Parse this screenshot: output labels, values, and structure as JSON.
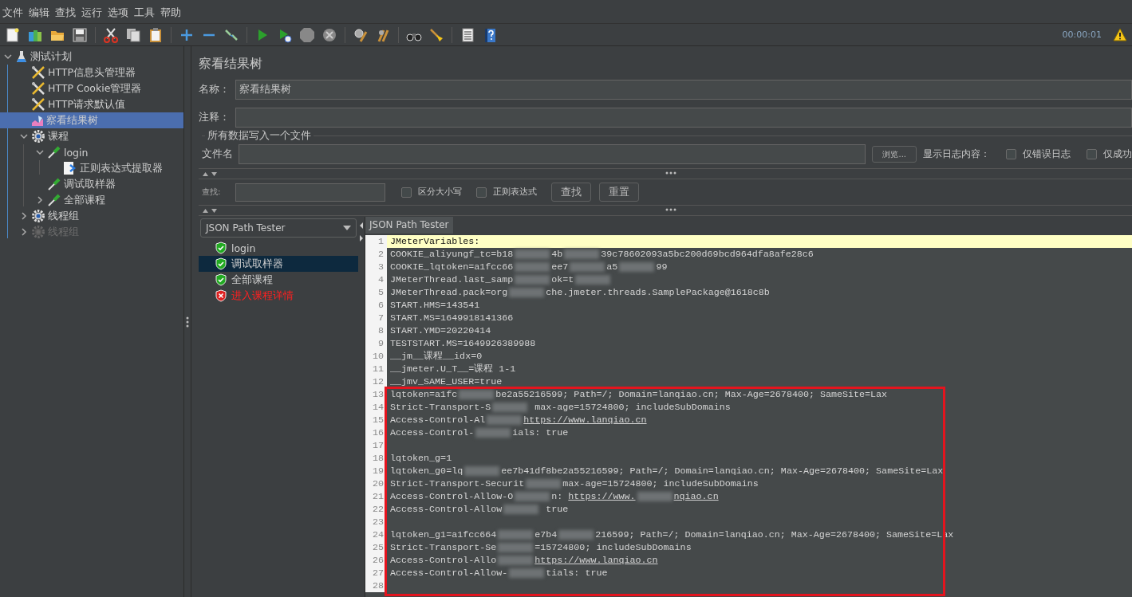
{
  "menu": [
    "文件",
    "编辑",
    "查找",
    "运行",
    "选项",
    "工具",
    "帮助"
  ],
  "toolbar": {
    "timer": "00:00:01"
  },
  "tree": [
    {
      "label": "测试计划",
      "kind": "plan",
      "expanded": true,
      "selected": false,
      "disabled": false,
      "children": [
        {
          "label": "HTTP信息头管理器",
          "kind": "config",
          "selected": false,
          "disabled": false
        },
        {
          "label": "HTTP Cookie管理器",
          "kind": "config",
          "selected": false,
          "disabled": false
        },
        {
          "label": "HTTP请求默认值",
          "kind": "config",
          "selected": false,
          "disabled": false
        },
        {
          "label": "察看结果树",
          "kind": "listener",
          "selected": true,
          "disabled": false
        },
        {
          "label": "课程",
          "kind": "thread_group",
          "expanded": true,
          "selected": false,
          "disabled": false,
          "children": [
            {
              "label": "login",
              "kind": "sampler",
              "expanded": true,
              "selected": false,
              "disabled": false,
              "children": [
                {
                  "label": "正则表达式提取器",
                  "kind": "extractor",
                  "selected": false,
                  "disabled": false
                }
              ]
            },
            {
              "label": "调试取样器",
              "kind": "sampler",
              "selected": false,
              "disabled": false
            },
            {
              "label": "全部课程",
              "kind": "sampler",
              "expanded": false,
              "selected": false,
              "disabled": false
            }
          ]
        },
        {
          "label": "线程组",
          "kind": "thread_group",
          "expanded": false,
          "selected": false,
          "disabled": false
        },
        {
          "label": "线程组",
          "kind": "thread_group",
          "expanded": false,
          "selected": false,
          "disabled": true
        }
      ]
    }
  ],
  "panel": {
    "title": "察看结果树",
    "name_label": "名称：",
    "name_value": "察看结果树",
    "comment_label": "注释：",
    "file_group": "所有数据写入一个文件",
    "file_label": "文件名",
    "browse": "浏览...",
    "log_label": "显示日志内容：",
    "log_options": [
      {
        "label": "仅错误日志",
        "checked": false
      },
      {
        "label": "仅成功",
        "checked": false
      }
    ]
  },
  "search": {
    "label": "查找:",
    "options": [
      {
        "label": "区分大小写",
        "checked": false
      },
      {
        "label": "正则表达式",
        "checked": false
      }
    ],
    "buttons": [
      "查找",
      "重置"
    ]
  },
  "renderer": {
    "value": "JSON Path Tester"
  },
  "results": [
    {
      "label": "login",
      "failed": false,
      "selected": false
    },
    {
      "label": "调试取样器",
      "failed": false,
      "selected": true
    },
    {
      "label": "全部课程",
      "failed": false,
      "selected": false
    },
    {
      "label": "进入课程详情",
      "failed": true,
      "selected": false
    }
  ],
  "tab": {
    "label": "JSON Path Tester"
  },
  "code": {
    "lines": [
      {
        "number": "1",
        "current": true,
        "segments": [
          {
            "kind": "text",
            "text": "JMeterVariables:"
          }
        ]
      },
      {
        "number": "2",
        "current": false,
        "segments": [
          {
            "kind": "text",
            "text": "COOKIE_aliyungf_tc=b18"
          },
          {
            "kind": "redacted"
          },
          {
            "kind": "text",
            "text": "4b"
          },
          {
            "kind": "redacted"
          },
          {
            "kind": "text",
            "text": "39c78602093a5bc200d69bcd964dfa8afe28c6"
          }
        ]
      },
      {
        "number": "3",
        "current": false,
        "segments": [
          {
            "kind": "text",
            "text": "COOKIE_lqtoken=a1fcc66"
          },
          {
            "kind": "redacted"
          },
          {
            "kind": "text",
            "text": "ee7"
          },
          {
            "kind": "redacted"
          },
          {
            "kind": "text",
            "text": "a5"
          },
          {
            "kind": "redacted"
          },
          {
            "kind": "text",
            "text": "99"
          }
        ]
      },
      {
        "number": "4",
        "current": false,
        "segments": [
          {
            "kind": "text",
            "text": "JMeterThread.last_samp"
          },
          {
            "kind": "redacted"
          },
          {
            "kind": "text",
            "text": "ok=t"
          },
          {
            "kind": "redacted"
          }
        ]
      },
      {
        "number": "5",
        "current": false,
        "segments": [
          {
            "kind": "text",
            "text": "JMeterThread.pack=org"
          },
          {
            "kind": "redacted"
          },
          {
            "kind": "text",
            "text": "che.jmeter.threads.SamplePackage@1618c8b"
          }
        ]
      },
      {
        "number": "6",
        "current": false,
        "segments": [
          {
            "kind": "text",
            "text": "START.HMS=143541"
          }
        ]
      },
      {
        "number": "7",
        "current": false,
        "segments": [
          {
            "kind": "text",
            "text": "START.MS=1649918141366"
          }
        ]
      },
      {
        "number": "8",
        "current": false,
        "segments": [
          {
            "kind": "text",
            "text": "START.YMD=20220414"
          }
        ]
      },
      {
        "number": "9",
        "current": false,
        "segments": [
          {
            "kind": "text",
            "text": "TESTSTART.MS=1649926389988"
          }
        ]
      },
      {
        "number": "10",
        "current": false,
        "segments": [
          {
            "kind": "text",
            "text": "__jm__课程__idx=0"
          }
        ]
      },
      {
        "number": "11",
        "current": false,
        "segments": [
          {
            "kind": "text",
            "text": "__jmeter.U_T__=课程 1-1"
          }
        ]
      },
      {
        "number": "12",
        "current": false,
        "segments": [
          {
            "kind": "text",
            "text": "__jmv_SAME_USER=true"
          }
        ]
      }
    ],
    "highlighted_lines": [
      {
        "number": "13",
        "current": false,
        "segments": [
          {
            "kind": "text",
            "text": "lqtoken=a1fc"
          },
          {
            "kind": "redacted"
          },
          {
            "kind": "text",
            "text": "be2a55216599; Path=/; Domain=lanqiao.cn; Max-Age=2678400; SameSite=Lax"
          }
        ]
      },
      {
        "number": "14",
        "current": false,
        "segments": [
          {
            "kind": "text",
            "text": "Strict-Transport-S"
          },
          {
            "kind": "redacted"
          },
          {
            "kind": "text",
            "text": " max-age=15724800; includeSubDomains"
          }
        ]
      },
      {
        "number": "15",
        "current": false,
        "segments": [
          {
            "kind": "text",
            "text": "Access-Control-Al"
          },
          {
            "kind": "redacted"
          },
          {
            "kind": "link",
            "text": "https://www.lanqiao.cn"
          }
        ]
      },
      {
        "number": "16",
        "current": false,
        "segments": [
          {
            "kind": "text",
            "text": "Access-Control-"
          },
          {
            "kind": "redacted"
          },
          {
            "kind": "text",
            "text": "ials: true"
          }
        ]
      },
      {
        "number": "17",
        "current": false
      },
      {
        "number": "18",
        "current": false,
        "segments": [
          {
            "kind": "text",
            "text": "lqtoken_g=1"
          }
        ]
      },
      {
        "number": "19",
        "current": false,
        "segments": [
          {
            "kind": "text",
            "text": "lqtoken_g0=lq"
          },
          {
            "kind": "redacted"
          },
          {
            "kind": "text",
            "text": "ee7b41df8be2a55216599; Path=/; Domain=lanqiao.cn; Max-Age=2678400; SameSite=Lax"
          }
        ]
      },
      {
        "number": "20",
        "current": false,
        "segments": [
          {
            "kind": "text",
            "text": "Strict-Transport-Securit"
          },
          {
            "kind": "redacted"
          },
          {
            "kind": "text",
            "text": "max-age=15724800; includeSubDomains"
          }
        ]
      },
      {
        "number": "21",
        "current": false,
        "segments": [
          {
            "kind": "text",
            "text": "Access-Control-Allow-O"
          },
          {
            "kind": "redacted"
          },
          {
            "kind": "text",
            "text": "n: "
          },
          {
            "kind": "link",
            "text": "https://www."
          },
          {
            "kind": "redacted"
          },
          {
            "kind": "link",
            "text": "nqiao.cn"
          }
        ]
      },
      {
        "number": "22",
        "current": false,
        "segments": [
          {
            "kind": "text",
            "text": "Access-Control-Allow"
          },
          {
            "kind": "redacted"
          },
          {
            "kind": "text",
            "text": " true"
          }
        ]
      },
      {
        "number": "23",
        "current": false
      },
      {
        "number": "24",
        "current": false,
        "segments": [
          {
            "kind": "text",
            "text": "lqtoken_g1=a1fcc664"
          },
          {
            "kind": "redacted"
          },
          {
            "kind": "text",
            "text": "e7b4"
          },
          {
            "kind": "redacted"
          },
          {
            "kind": "text",
            "text": "216599; Path=/; Domain=lanqiao.cn; Max-Age=2678400; SameSite=Lax"
          }
        ]
      },
      {
        "number": "25",
        "current": false,
        "segments": [
          {
            "kind": "text",
            "text": "Strict-Transport-Se"
          },
          {
            "kind": "redacted"
          },
          {
            "kind": "text",
            "text": "=15724800; includeSubDomains"
          }
        ]
      },
      {
        "number": "26",
        "current": false,
        "segments": [
          {
            "kind": "text",
            "text": "Access-Control-Allo"
          },
          {
            "kind": "redacted"
          },
          {
            "kind": "link",
            "text": "https://www.lanqiao.cn"
          }
        ]
      },
      {
        "number": "27",
        "current": false,
        "segments": [
          {
            "kind": "text",
            "text": "Access-Control-Allow-"
          },
          {
            "kind": "redacted"
          },
          {
            "kind": "text",
            "text": "tials: true"
          }
        ]
      },
      {
        "number": "28",
        "current": false
      }
    ]
  }
}
